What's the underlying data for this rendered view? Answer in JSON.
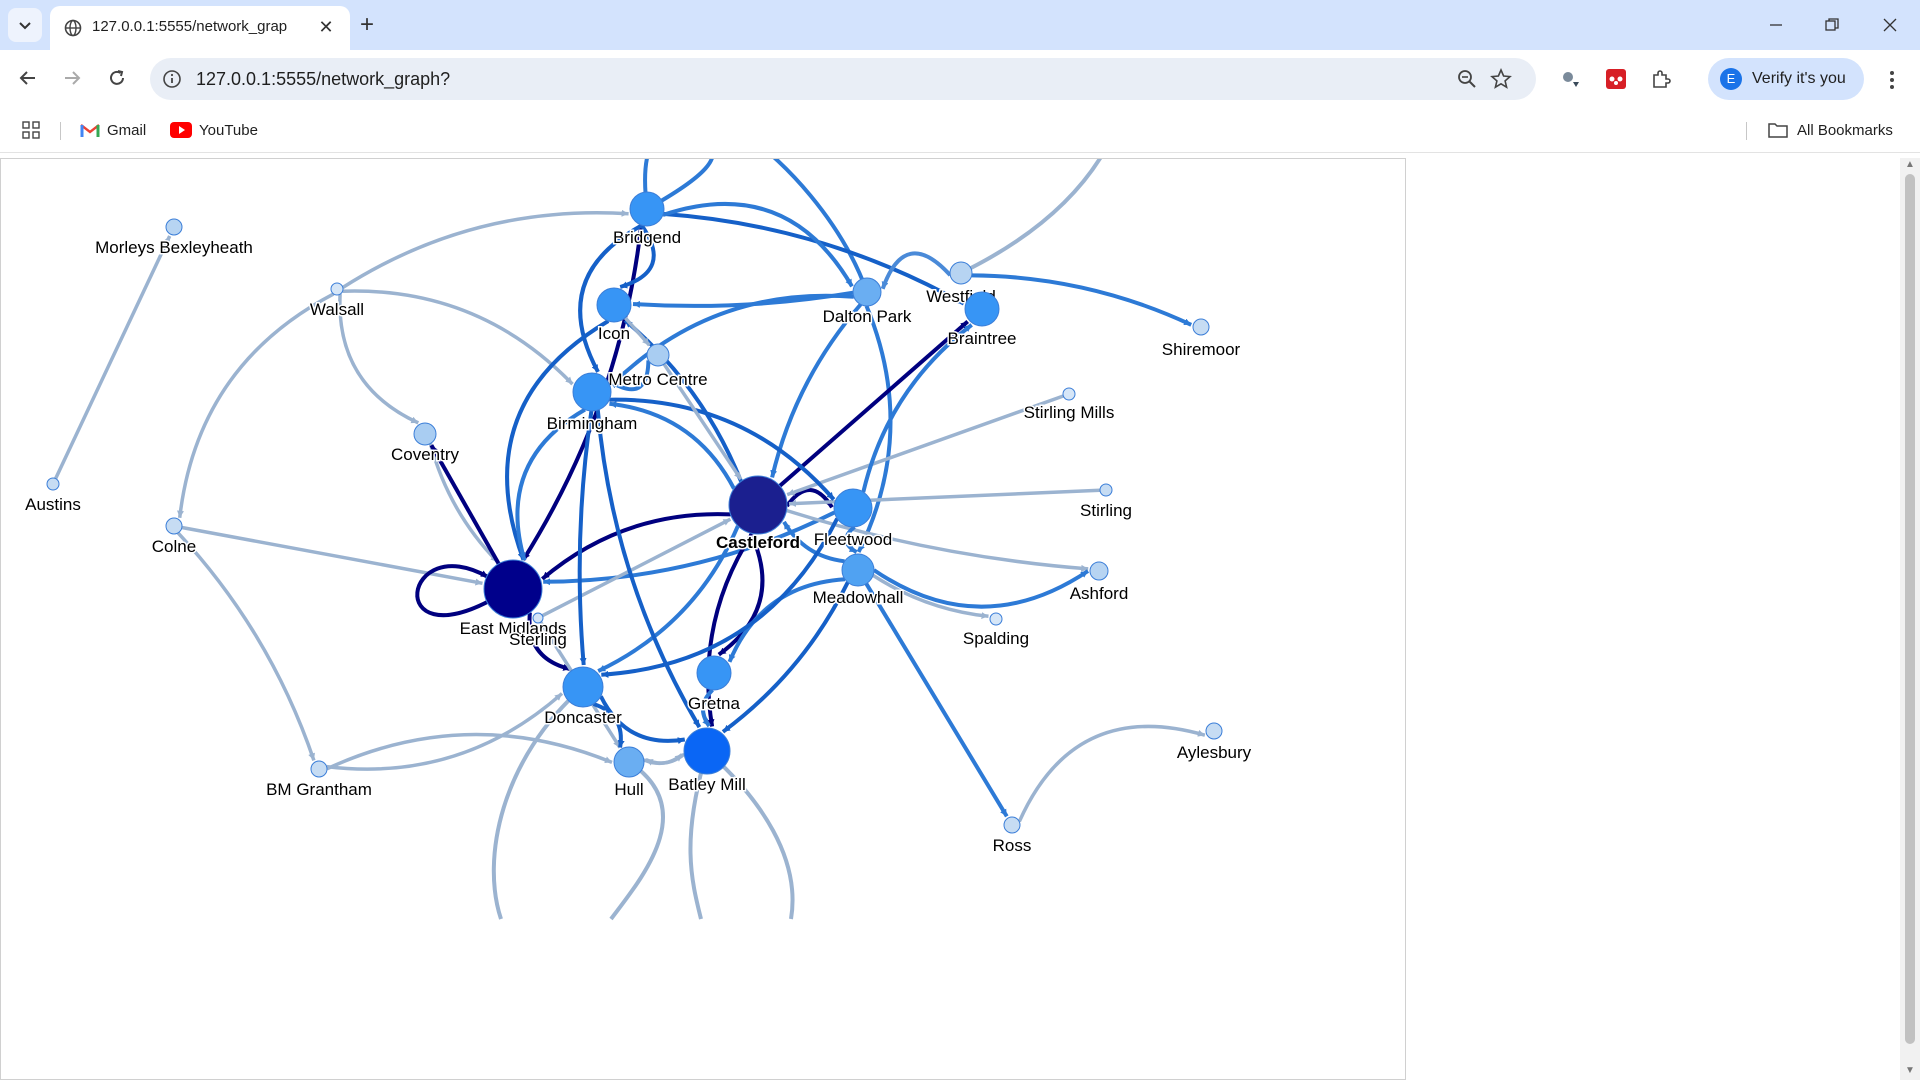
{
  "browser": {
    "tab_title": "127.0.0.1:5555/network_grap",
    "url": "127.0.0.1:5555/network_graph?",
    "verify_label": "Verify it's you",
    "avatar_letter": "E"
  },
  "bookmarks": {
    "items": [
      {
        "label": "Gmail"
      },
      {
        "label": "YouTube"
      }
    ],
    "all_label": "All Bookmarks"
  },
  "graph": {
    "nodes": [
      {
        "id": "morleys",
        "label": "Morleys Bexleyheath",
        "color": "#b7d4f2",
        "bold": false
      },
      {
        "id": "walsall",
        "label": "Walsall",
        "color": "#d6e6f7",
        "bold": false
      },
      {
        "id": "austins",
        "label": "Austins",
        "color": "#c6dcf3",
        "bold": false
      },
      {
        "id": "colne",
        "label": "Colne",
        "color": "#c6dcf3",
        "bold": false
      },
      {
        "id": "bmgrantham",
        "label": "BM Grantham",
        "color": "#c6dcf3",
        "bold": false
      },
      {
        "id": "coventry",
        "label": "Coventry",
        "color": "#a9cdf2",
        "bold": false
      },
      {
        "id": "eastmidlands",
        "label": "East Midlands",
        "color": "#00008b",
        "bold": false
      },
      {
        "id": "bridgend",
        "label": "Bridgend",
        "color": "#3795f5",
        "bold": false
      },
      {
        "id": "icon",
        "label": "Icon",
        "color": "#3795f5",
        "bold": false
      },
      {
        "id": "metrocentre",
        "label": "Metro Centre",
        "color": "#a9cdf2",
        "bold": false
      },
      {
        "id": "birmingham",
        "label": "Birmingham",
        "color": "#3795f5",
        "bold": false
      },
      {
        "id": "sterling",
        "label": "Sterling",
        "color": "#d6e6f7",
        "bold": false
      },
      {
        "id": "doncaster",
        "label": "Doncaster",
        "color": "#3795f5",
        "bold": false
      },
      {
        "id": "hull",
        "label": "Hull",
        "color": "#6aaef2",
        "bold": false
      },
      {
        "id": "batleymill",
        "label": "Batley Mill",
        "color": "#0a66f5",
        "bold": false
      },
      {
        "id": "gretna",
        "label": "Gretna",
        "color": "#3795f5",
        "bold": false
      },
      {
        "id": "castleford",
        "label": "Castleford",
        "color": "#1b1f8f",
        "bold": true
      },
      {
        "id": "fleetwood",
        "label": "Fleetwood",
        "color": "#3795f5",
        "bold": false
      },
      {
        "id": "meadowhall",
        "label": "Meadowhall",
        "color": "#50a2f2",
        "bold": false
      },
      {
        "id": "daltonpark",
        "label": "Dalton Park",
        "color": "#6aaef2",
        "bold": false
      },
      {
        "id": "westfield",
        "label": "Westfield",
        "color": "#b7d4f2",
        "bold": false
      },
      {
        "id": "braintree",
        "label": "Braintree",
        "color": "#3795f5",
        "bold": false
      },
      {
        "id": "shiremoor",
        "label": "Shiremoor",
        "color": "#c6dcf3",
        "bold": false
      },
      {
        "id": "stirlingmills",
        "label": "Stirling Mills",
        "color": "#d6e6f7",
        "bold": false
      },
      {
        "id": "stirling",
        "label": "Stirling",
        "color": "#c6dcf3",
        "bold": false
      },
      {
        "id": "ashford",
        "label": "Ashford",
        "color": "#b7d4f2",
        "bold": false
      },
      {
        "id": "spalding",
        "label": "Spalding",
        "color": "#d6e6f7",
        "bold": false
      },
      {
        "id": "aylesbury",
        "label": "Aylesbury",
        "color": "#c6dcf3",
        "bold": false
      },
      {
        "id": "ross",
        "label": "Ross",
        "color": "#c6dcf3",
        "bold": false
      }
    ],
    "edges": [
      {
        "from": "austins",
        "to": "morleys",
        "color": "#9bb3d0"
      },
      {
        "from": "walsall",
        "to": "colne",
        "color": "#9bb3d0"
      },
      {
        "from": "walsall",
        "to": "birmingham",
        "color": "#9bb3d0"
      },
      {
        "from": "walsall",
        "to": "coventry",
        "color": "#9bb3d0"
      },
      {
        "from": "walsall",
        "to": "bridgend",
        "color": "#9bb3d0"
      },
      {
        "from": "colne",
        "to": "eastmidlands",
        "color": "#9bb3d0"
      },
      {
        "from": "colne",
        "to": "bmgrantham",
        "color": "#9bb3d0"
      },
      {
        "from": "bmgrantham",
        "to": "hull",
        "color": "#9bb3d0"
      },
      {
        "from": "bmgrantham",
        "to": "doncaster",
        "color": "#9bb3d0"
      },
      {
        "from": "coventry",
        "to": "eastmidlands",
        "color": "#9bb3d0"
      },
      {
        "from": "eastmidlands",
        "to": "coventry",
        "color": "#00007f"
      },
      {
        "from": "eastmidlands",
        "to": "eastmidlands",
        "color": "#00007f"
      },
      {
        "from": "castleford",
        "to": "eastmidlands",
        "color": "#00007f"
      },
      {
        "from": "eastmidlands",
        "to": "doncaster",
        "color": "#00007f"
      },
      {
        "from": "bridgend",
        "to": "eastmidlands",
        "color": "#00007f"
      },
      {
        "from": "icon",
        "to": "eastmidlands",
        "color": "#1560c8"
      },
      {
        "from": "birmingham",
        "to": "eastmidlands",
        "color": "#2d7ad6"
      },
      {
        "from": "fleetwood",
        "to": "eastmidlands",
        "color": "#2d7ad6"
      },
      {
        "from": "bridgend",
        "to": "icon",
        "color": "#1560c8"
      },
      {
        "from": "bridgend",
        "to": "birmingham",
        "color": "#1560c8"
      },
      {
        "from": "bridgend",
        "to": "braintree",
        "color": "#1560c8"
      },
      {
        "from": "bridgend",
        "to": "daltonpark",
        "color": "#2d7ad6"
      },
      {
        "from": "daltonpark",
        "to": "icon",
        "color": "#2d7ad6"
      },
      {
        "from": "daltonpark",
        "to": "birmingham",
        "color": "#2d7ad6"
      },
      {
        "from": "daltonpark",
        "to": "castleford",
        "color": "#2d7ad6"
      },
      {
        "from": "daltonpark",
        "to": "meadowhall",
        "color": "#2d7ad6"
      },
      {
        "from": "westfield",
        "to": "shiremoor",
        "color": "#2d7ad6"
      },
      {
        "from": "westfield",
        "to": "daltonpark",
        "color": "#4a8ad8"
      },
      {
        "from": "castleford",
        "to": "braintree",
        "color": "#00007f"
      },
      {
        "from": "castleford",
        "to": "fleetwood",
        "color": "#00007f"
      },
      {
        "from": "castleford",
        "to": "gretna",
        "color": "#00007f"
      },
      {
        "from": "castleford",
        "to": "batleymill",
        "color": "#00007f"
      },
      {
        "from": "castleford",
        "to": "birmingham",
        "color": "#2d7ad6"
      },
      {
        "from": "castleford",
        "to": "icon",
        "color": "#1560c8"
      },
      {
        "from": "castleford",
        "to": "doncaster",
        "color": "#2d7ad6"
      },
      {
        "from": "castleford",
        "to": "ashford",
        "color": "#9bb3d0"
      },
      {
        "from": "stirlingmills",
        "to": "castleford",
        "color": "#9bb3d0"
      },
      {
        "from": "stirling",
        "to": "castleford",
        "color": "#9bb3d0"
      },
      {
        "from": "sterling",
        "to": "castleford",
        "color": "#9bb3d0"
      },
      {
        "from": "sterling",
        "to": "hull",
        "color": "#9bb3d0"
      },
      {
        "from": "meadowhall",
        "to": "castleford",
        "color": "#2d7ad6"
      },
      {
        "from": "meadowhall",
        "to": "ashford",
        "color": "#2d7ad6"
      },
      {
        "from": "meadowhall",
        "to": "spalding",
        "color": "#9bb3d0"
      },
      {
        "from": "meadowhall",
        "to": "ross",
        "color": "#2d7ad6"
      },
      {
        "from": "meadowhall",
        "to": "gretna",
        "color": "#2d7ad6"
      },
      {
        "from": "meadowhall",
        "to": "batleymill",
        "color": "#1560c8"
      },
      {
        "from": "fleetwood",
        "to": "braintree",
        "color": "#2d7ad6"
      },
      {
        "from": "fleetwood",
        "to": "doncaster",
        "color": "#1560c8"
      },
      {
        "from": "fleetwood",
        "to": "meadowhall",
        "color": "#2d7ad6"
      },
      {
        "from": "birmingham",
        "to": "doncaster",
        "color": "#1560c8"
      },
      {
        "from": "birmingham",
        "to": "batleymill",
        "color": "#1560c8"
      },
      {
        "from": "birmingham",
        "to": "fleetwood",
        "color": "#1560c8"
      },
      {
        "from": "icon",
        "to": "metrocentre",
        "color": "#9bb3d0"
      },
      {
        "from": "metrocentre",
        "to": "birmingham",
        "color": "#2d7ad6"
      },
      {
        "from": "metrocentre",
        "to": "castleford",
        "color": "#9bb3d0"
      },
      {
        "from": "doncaster",
        "to": "hull",
        "color": "#1560c8"
      },
      {
        "from": "doncaster",
        "to": "batleymill",
        "color": "#1560c8"
      },
      {
        "from": "hull",
        "to": "batleymill",
        "color": "#9bb3d0"
      },
      {
        "from": "batleymill",
        "to": "hull",
        "color": "#9bb3d0"
      },
      {
        "from": "gretna",
        "to": "batleymill",
        "color": "#2d7ad6"
      },
      {
        "from": "ross",
        "to": "aylesbury",
        "color": "#9bb3d0"
      }
    ]
  }
}
